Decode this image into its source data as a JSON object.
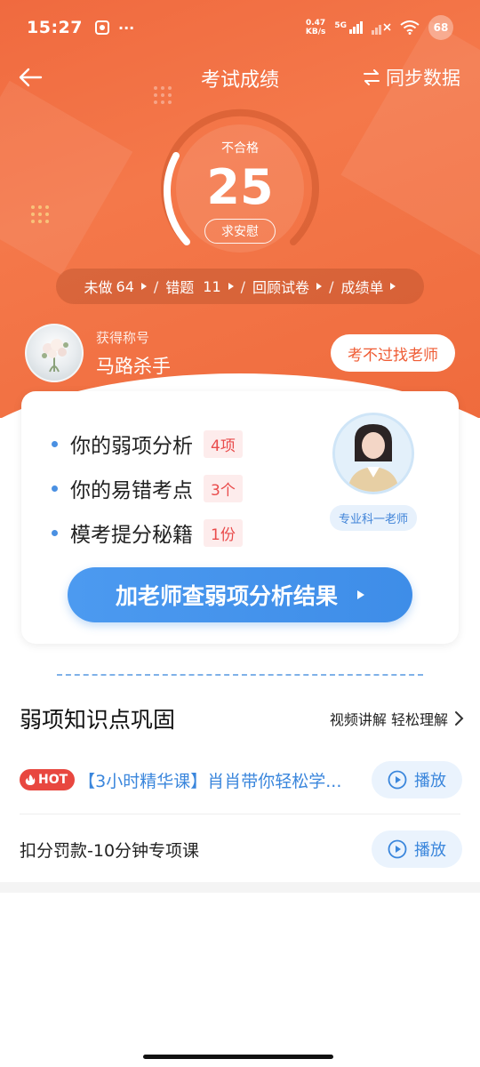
{
  "status_bar": {
    "time": "15:27",
    "more": "···",
    "net_speed_value": "0.47",
    "net_speed_unit": "KB/s",
    "network": "5G",
    "battery": "68"
  },
  "nav": {
    "title": "考试成绩",
    "sync_label": "同步数据"
  },
  "score": {
    "status": "不合格",
    "value": "25",
    "comfort_label": "求安慰"
  },
  "stats": {
    "undone_label": "未做",
    "undone_count": "64",
    "wrong_label": "错题",
    "wrong_count": "11",
    "review_label": "回顾试卷",
    "report_label": "成绩单",
    "separator": "/"
  },
  "profile": {
    "title_label": "获得称号",
    "title_value": "马路杀手",
    "find_teacher_label": "考不过找老师"
  },
  "analysis": {
    "items": [
      {
        "label": "你的弱项分析",
        "badge": "4项"
      },
      {
        "label": "你的易错考点",
        "badge": "3个"
      },
      {
        "label": "模考提分秘籍",
        "badge": "1份"
      }
    ],
    "teacher_tag": "专业科一老师",
    "cta_label": "加老师查弱项分析结果"
  },
  "section": {
    "title": "弱项知识点巩固",
    "more_label": "视频讲解 轻松理解"
  },
  "lessons": [
    {
      "hot": "HOT",
      "title": "【3小时精华课】肖肖带你轻松学...",
      "play_label": "播放"
    },
    {
      "title": "扣分罚款-10分钟专项课",
      "play_label": "播放"
    }
  ],
  "colors": {
    "hero": "#f06a3f",
    "accent_blue": "#3e8de8",
    "badge_red": "#e94b4b"
  },
  "icons": [
    "back-arrow-icon",
    "sync-icon",
    "play-icon",
    "chevron-right-icon",
    "fire-icon"
  ]
}
